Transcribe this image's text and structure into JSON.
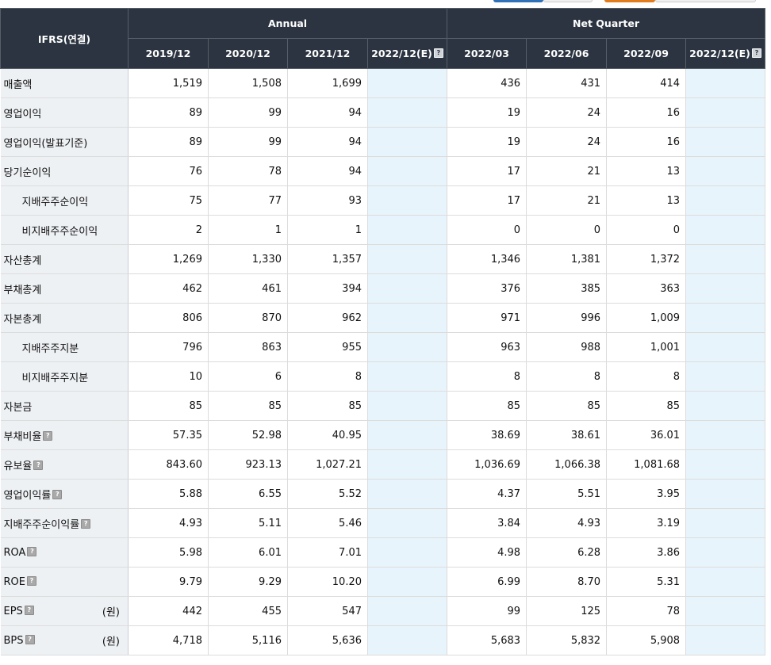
{
  "header": {
    "corner": "IFRS(연결)",
    "group_annual": "Annual",
    "group_quarter": "Net Quarter",
    "annual_periods": [
      "2019/12",
      "2020/12",
      "2021/12",
      "2022/12(E)"
    ],
    "quarter_periods": [
      "2022/03",
      "2022/06",
      "2022/09",
      "2022/12(E)"
    ]
  },
  "rows": [
    {
      "label": "매출액",
      "indent": false,
      "help": false,
      "unit": "",
      "annual": [
        "1,519",
        "1,508",
        "1,699",
        ""
      ],
      "quarter": [
        "436",
        "431",
        "414",
        ""
      ]
    },
    {
      "label": "영업이익",
      "indent": false,
      "help": false,
      "unit": "",
      "annual": [
        "89",
        "99",
        "94",
        ""
      ],
      "quarter": [
        "19",
        "24",
        "16",
        ""
      ]
    },
    {
      "label": "영업이익(발표기준)",
      "indent": false,
      "help": false,
      "unit": "",
      "annual": [
        "89",
        "99",
        "94",
        ""
      ],
      "quarter": [
        "19",
        "24",
        "16",
        ""
      ]
    },
    {
      "label": "당기순이익",
      "indent": false,
      "help": false,
      "unit": "",
      "annual": [
        "76",
        "78",
        "94",
        ""
      ],
      "quarter": [
        "17",
        "21",
        "13",
        ""
      ]
    },
    {
      "label": "지배주주순이익",
      "indent": true,
      "help": false,
      "unit": "",
      "annual": [
        "75",
        "77",
        "93",
        ""
      ],
      "quarter": [
        "17",
        "21",
        "13",
        ""
      ]
    },
    {
      "label": "비지배주주순이익",
      "indent": true,
      "help": false,
      "unit": "",
      "annual": [
        "2",
        "1",
        "1",
        ""
      ],
      "quarter": [
        "0",
        "0",
        "0",
        ""
      ]
    },
    {
      "label": "자산총계",
      "indent": false,
      "help": false,
      "unit": "",
      "annual": [
        "1,269",
        "1,330",
        "1,357",
        ""
      ],
      "quarter": [
        "1,346",
        "1,381",
        "1,372",
        ""
      ]
    },
    {
      "label": "부채총계",
      "indent": false,
      "help": false,
      "unit": "",
      "annual": [
        "462",
        "461",
        "394",
        ""
      ],
      "quarter": [
        "376",
        "385",
        "363",
        ""
      ]
    },
    {
      "label": "자본총계",
      "indent": false,
      "help": false,
      "unit": "",
      "annual": [
        "806",
        "870",
        "962",
        ""
      ],
      "quarter": [
        "971",
        "996",
        "1,009",
        ""
      ]
    },
    {
      "label": "지배주주지분",
      "indent": true,
      "help": false,
      "unit": "",
      "annual": [
        "796",
        "863",
        "955",
        ""
      ],
      "quarter": [
        "963",
        "988",
        "1,001",
        ""
      ]
    },
    {
      "label": "비지배주주지분",
      "indent": true,
      "help": false,
      "unit": "",
      "annual": [
        "10",
        "6",
        "8",
        ""
      ],
      "quarter": [
        "8",
        "8",
        "8",
        ""
      ]
    },
    {
      "label": "자본금",
      "indent": false,
      "help": false,
      "unit": "",
      "annual": [
        "85",
        "85",
        "85",
        ""
      ],
      "quarter": [
        "85",
        "85",
        "85",
        ""
      ]
    },
    {
      "label": "부채비율",
      "indent": false,
      "help": true,
      "unit": "",
      "annual": [
        "57.35",
        "52.98",
        "40.95",
        ""
      ],
      "quarter": [
        "38.69",
        "38.61",
        "36.01",
        ""
      ]
    },
    {
      "label": "유보율",
      "indent": false,
      "help": true,
      "unit": "",
      "annual": [
        "843.60",
        "923.13",
        "1,027.21",
        ""
      ],
      "quarter": [
        "1,036.69",
        "1,066.38",
        "1,081.68",
        ""
      ]
    },
    {
      "label": "영업이익률",
      "indent": false,
      "help": true,
      "unit": "",
      "annual": [
        "5.88",
        "6.55",
        "5.52",
        ""
      ],
      "quarter": [
        "4.37",
        "5.51",
        "3.95",
        ""
      ]
    },
    {
      "label": "지배주주순이익률",
      "indent": false,
      "help": true,
      "unit": "",
      "annual": [
        "4.93",
        "5.11",
        "5.46",
        ""
      ],
      "quarter": [
        "3.84",
        "4.93",
        "3.19",
        ""
      ]
    },
    {
      "label": "ROA",
      "indent": false,
      "help": true,
      "unit": "",
      "annual": [
        "5.98",
        "6.01",
        "7.01",
        ""
      ],
      "quarter": [
        "4.98",
        "6.28",
        "3.86",
        ""
      ]
    },
    {
      "label": "ROE",
      "indent": false,
      "help": true,
      "unit": "",
      "annual": [
        "9.79",
        "9.29",
        "10.20",
        ""
      ],
      "quarter": [
        "6.99",
        "8.70",
        "5.31",
        ""
      ]
    },
    {
      "label": "EPS",
      "indent": false,
      "help": true,
      "unit": "(원)",
      "annual": [
        "442",
        "455",
        "547",
        ""
      ],
      "quarter": [
        "99",
        "125",
        "78",
        ""
      ]
    },
    {
      "label": "BPS",
      "indent": false,
      "help": true,
      "unit": "(원)",
      "annual": [
        "4,718",
        "5,116",
        "5,636",
        ""
      ],
      "quarter": [
        "5,683",
        "5,832",
        "5,908",
        ""
      ]
    }
  ],
  "help_glyph": "?",
  "colors": {
    "header_bg": "#2b3440",
    "label_bg": "#eef1f4",
    "estimate_bg": "#e8f4fb"
  }
}
